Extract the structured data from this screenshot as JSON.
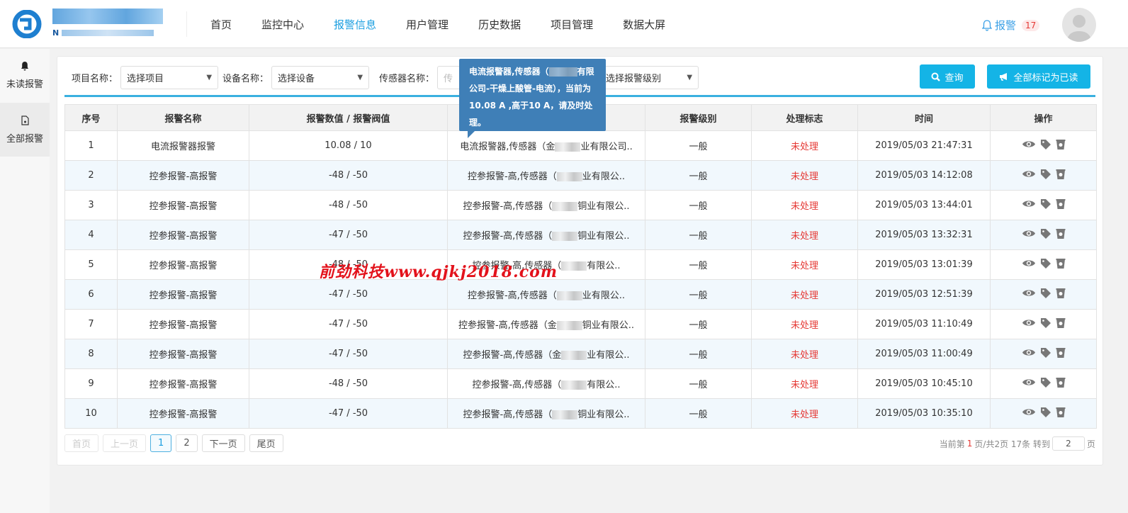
{
  "header": {
    "nav": [
      "首页",
      "监控中心",
      "报警信息",
      "用户管理",
      "历史数据",
      "项目管理",
      "数据大屏"
    ],
    "active_nav": 2,
    "alarm_label": "报警",
    "alarm_count": "17",
    "brand_en_initial": "N"
  },
  "sidebar": {
    "items": [
      "未读报警",
      "全部报警"
    ]
  },
  "filters": {
    "project_label": "项目名称：",
    "project_value": "选择项目",
    "device_label": "设备名称：",
    "device_value": "选择设备",
    "sensor_label": "传感器名称：",
    "sensor_placeholder": "传",
    "level_value": "选择报警级别",
    "query_btn": "查询",
    "mark_all_btn": "全部标记为已读"
  },
  "table": {
    "headers": [
      "序号",
      "报警名称",
      "报警数值 / 报警阀值",
      "",
      "报警级别",
      "处理标志",
      "时间",
      "操作"
    ],
    "rows": [
      [
        "1",
        "电流报警器报警",
        "10.08 / 10",
        "电流报警器,传感器（金",
        "业有限公司..",
        "一般",
        "未处理",
        "2019/05/03 21:47:31"
      ],
      [
        "2",
        "控参报警-高报警",
        "-48 / -50",
        "控参报警-高,传感器（",
        "业有限公..",
        "一般",
        "未处理",
        "2019/05/03 14:12:08"
      ],
      [
        "3",
        "控参报警-高报警",
        "-48 / -50",
        "控参报警-高,传感器（",
        "铜业有限公..",
        "一般",
        "未处理",
        "2019/05/03 13:44:01"
      ],
      [
        "4",
        "控参报警-高报警",
        "-47 / -50",
        "控参报警-高,传感器（",
        "铜业有限公..",
        "一般",
        "未处理",
        "2019/05/03 13:32:31"
      ],
      [
        "5",
        "控参报警-高报警",
        "-48 / -50",
        "控参报警-高,传感器（",
        "有限公..",
        "一般",
        "未处理",
        "2019/05/03 13:01:39"
      ],
      [
        "6",
        "控参报警-高报警",
        "-47 / -50",
        "控参报警-高,传感器（",
        "业有限公..",
        "一般",
        "未处理",
        "2019/05/03 12:51:39"
      ],
      [
        "7",
        "控参报警-高报警",
        "-47 / -50",
        "控参报警-高,传感器（金",
        "铜业有限公..",
        "一般",
        "未处理",
        "2019/05/03 11:10:49"
      ],
      [
        "8",
        "控参报警-高报警",
        "-47 / -50",
        "控参报警-高,传感器（金",
        "业有限公..",
        "一般",
        "未处理",
        "2019/05/03 11:00:49"
      ],
      [
        "9",
        "控参报警-高报警",
        "-48 / -50",
        "控参报警-高,传感器（",
        "有限公..",
        "一般",
        "未处理",
        "2019/05/03 10:45:10"
      ],
      [
        "10",
        "控参报警-高报警",
        "-47 / -50",
        "控参报警-高,传感器（",
        "铜业有限公..",
        "一般",
        "未处理",
        "2019/05/03 10:35:10"
      ]
    ]
  },
  "pager": {
    "first": "首页",
    "prev": "上一页",
    "pages": [
      "1",
      "2"
    ],
    "next": "下一页",
    "last": "尾页",
    "info_prefix": "当前第",
    "info_cur": "1",
    "info_suffix": "页/共2页 17条 转到",
    "jump_value": "2",
    "page_unit": "页"
  },
  "tooltip": {
    "line1": "电流报警器,传感器（",
    "line1_end": "有",
    "text": "限公司-干燥上酸管-电流），当前为10.08 A ,高于10 A，请及时处理。"
  },
  "watermark": "前劲科技www.qjkj2018.com"
}
